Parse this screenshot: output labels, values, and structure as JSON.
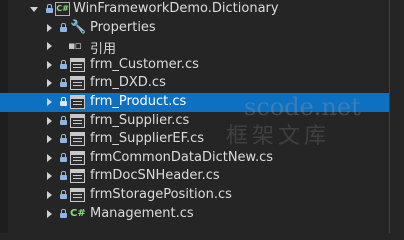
{
  "solution_explorer": {
    "project": {
      "label": "WinFrameworkDemo.Dictionary",
      "icon": "csharp-project-icon",
      "expanded": true
    },
    "items": [
      {
        "label": "Properties",
        "icon": "wrench-icon",
        "expander": "collapsed",
        "locked": true
      },
      {
        "label": "引用",
        "icon": "references-icon",
        "expander": "collapsed",
        "locked": false
      },
      {
        "label": "frm_Customer.cs",
        "icon": "form-icon",
        "expander": "collapsed",
        "locked": true
      },
      {
        "label": "frm_DXD.cs",
        "icon": "form-icon",
        "expander": "collapsed",
        "locked": true
      },
      {
        "label": "frm_Product.cs",
        "icon": "form-icon",
        "expander": "collapsed",
        "locked": true,
        "selected": true
      },
      {
        "label": "frm_Supplier.cs",
        "icon": "form-icon",
        "expander": "collapsed",
        "locked": true
      },
      {
        "label": "frm_SupplierEF.cs",
        "icon": "form-icon",
        "expander": "collapsed",
        "locked": true
      },
      {
        "label": "frmCommonDataDictNew.cs",
        "icon": "form-icon",
        "expander": "collapsed",
        "locked": true
      },
      {
        "label": "frmDocSNHeader.cs",
        "icon": "form-icon",
        "expander": "collapsed",
        "locked": true
      },
      {
        "label": "frmStoragePosition.cs",
        "icon": "form-icon",
        "expander": "collapsed",
        "locked": true
      },
      {
        "label": "Management.cs",
        "icon": "csharp-file-icon",
        "expander": "collapsed",
        "locked": true
      }
    ]
  },
  "watermark": {
    "line1": "scode.net",
    "line2": "框架文库"
  },
  "colors": {
    "background": "#252526",
    "selection": "#0e70c0",
    "text": "#dcdcdc",
    "lock": "#8fb5e6",
    "csharp": "#8cd97e"
  }
}
